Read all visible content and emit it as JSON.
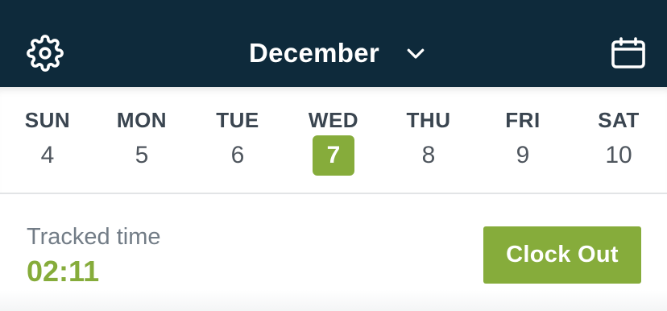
{
  "header": {
    "month_label": "December",
    "settings_icon": "gear-icon",
    "dropdown_icon": "chevron-down-icon",
    "calendar_icon": "calendar-icon",
    "background_color": "#0e2a3b"
  },
  "week": {
    "days": [
      {
        "name": "SUN",
        "number": "4",
        "selected": false
      },
      {
        "name": "MON",
        "number": "5",
        "selected": false
      },
      {
        "name": "TUE",
        "number": "6",
        "selected": false
      },
      {
        "name": "WED",
        "number": "7",
        "selected": true
      },
      {
        "name": "THU",
        "number": "8",
        "selected": false
      },
      {
        "name": "FRI",
        "number": "9",
        "selected": false
      },
      {
        "name": "SAT",
        "number": "10",
        "selected": false
      }
    ],
    "selected_color": "#86ac3b"
  },
  "tracking": {
    "label": "Tracked time",
    "value": "02:11",
    "button_label": "Clock Out",
    "accent_color": "#86ac3b"
  }
}
